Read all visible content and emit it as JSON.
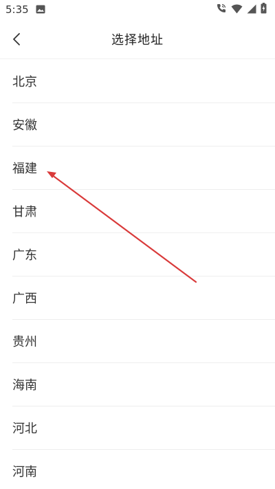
{
  "status_bar": {
    "time": "5:35",
    "left_icons": [
      "image-icon"
    ],
    "right_icons": [
      "wifi-calling-icon",
      "wifi-icon",
      "signal-icon",
      "battery-charging-icon"
    ]
  },
  "header": {
    "title": "选择地址",
    "back_icon": "chevron-left-icon"
  },
  "provinces": [
    "北京",
    "安徽",
    "福建",
    "甘肃",
    "广东",
    "广西",
    "贵州",
    "海南",
    "河北",
    "河南"
  ],
  "annotation": {
    "color": "#d93a3a",
    "points_to": "福建"
  }
}
